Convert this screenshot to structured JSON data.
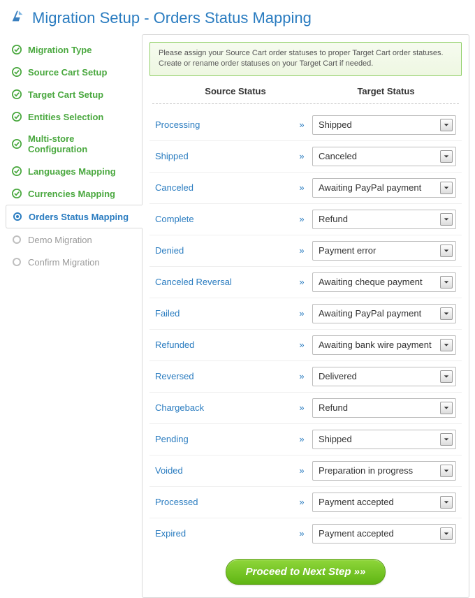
{
  "header": {
    "title": "Migration Setup - Orders Status Mapping"
  },
  "sidebar": {
    "items": [
      {
        "label": "Migration Type",
        "state": "done"
      },
      {
        "label": "Source Cart Setup",
        "state": "done"
      },
      {
        "label": "Target Cart Setup",
        "state": "done"
      },
      {
        "label": "Entities Selection",
        "state": "done"
      },
      {
        "label": "Multi-store Configuration",
        "state": "done"
      },
      {
        "label": "Languages Mapping",
        "state": "done"
      },
      {
        "label": "Currencies Mapping",
        "state": "done"
      },
      {
        "label": "Orders Status Mapping",
        "state": "active"
      },
      {
        "label": "Demo Migration",
        "state": "pending"
      },
      {
        "label": "Confirm Migration",
        "state": "pending"
      }
    ]
  },
  "info": {
    "line1": "Please assign your Source Cart order statuses to proper Target Cart order statuses.",
    "line2": "Create or rename order statuses on your Target Cart if needed."
  },
  "columns": {
    "source": "Source Status",
    "target": "Target Status"
  },
  "arrow": "»",
  "mappings": [
    {
      "source": "Processing",
      "target": "Shipped"
    },
    {
      "source": "Shipped",
      "target": "Canceled"
    },
    {
      "source": "Canceled",
      "target": "Awaiting PayPal payment"
    },
    {
      "source": "Complete",
      "target": "Refund"
    },
    {
      "source": "Denied",
      "target": "Payment error"
    },
    {
      "source": "Canceled Reversal",
      "target": "Awaiting cheque payment"
    },
    {
      "source": "Failed",
      "target": "Awaiting PayPal payment"
    },
    {
      "source": "Refunded",
      "target": "Awaiting bank wire payment"
    },
    {
      "source": "Reversed",
      "target": "Delivered"
    },
    {
      "source": "Chargeback",
      "target": "Refund"
    },
    {
      "source": "Pending",
      "target": "Shipped"
    },
    {
      "source": "Voided",
      "target": "Preparation in progress"
    },
    {
      "source": "Processed",
      "target": "Payment accepted"
    },
    {
      "source": "Expired",
      "target": "Payment accepted"
    }
  ],
  "proceed": {
    "label": "Proceed to Next Step »»"
  }
}
